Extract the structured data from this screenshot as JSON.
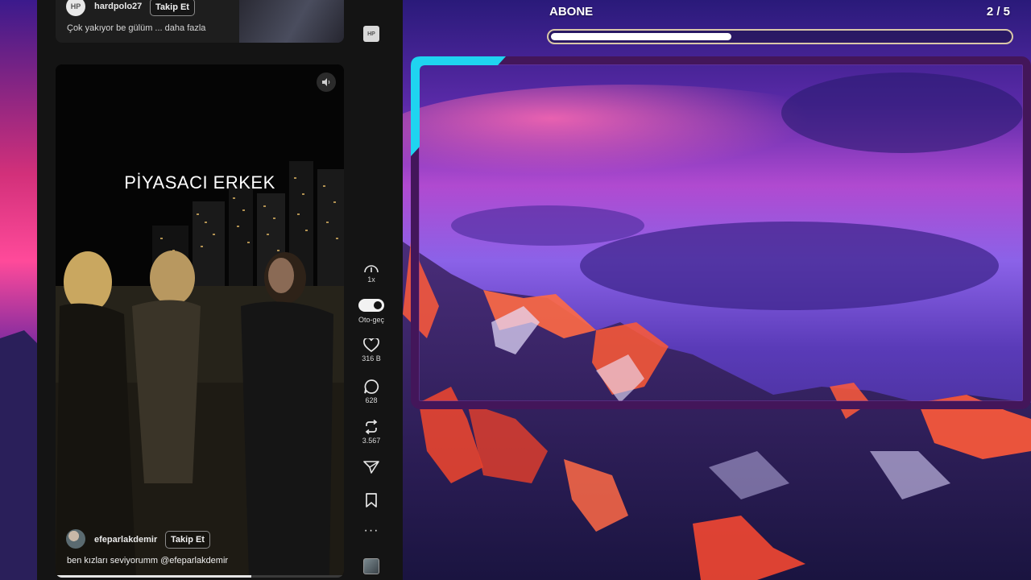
{
  "top_post": {
    "avatar_text": "HP",
    "username": "hardpolo27",
    "follow_label": "Takip Et",
    "caption": "Çok yakıyor be gülüm ... daha fazla"
  },
  "video_post": {
    "overlay_text": "PİYASACI ERKEK",
    "username": "efeparlakdemir",
    "follow_label": "Takip Et",
    "caption": "ben kızları seviyorumm @efeparlakdemir",
    "progress": 0.68
  },
  "actions": {
    "more_top": "···",
    "top_thumb_text": "HP",
    "speed": "1x",
    "autoplay_label": "Oto-geç",
    "likes": "316 B",
    "comments": "628",
    "reposts": "3.567",
    "more": "···",
    "icons": [
      "speed-icon",
      "toggle-icon",
      "heart-icon",
      "comment-icon",
      "repost-icon",
      "share-icon",
      "bookmark-icon",
      "more-icon"
    ]
  },
  "goal": {
    "label": "ABONE",
    "count": "2 / 5",
    "progress": 0.4
  },
  "colors": {
    "frame": "#43165a",
    "frame_accent": "#1fd4f0",
    "panel_bg": "#141414",
    "goal_border": "#d9c7a8"
  }
}
